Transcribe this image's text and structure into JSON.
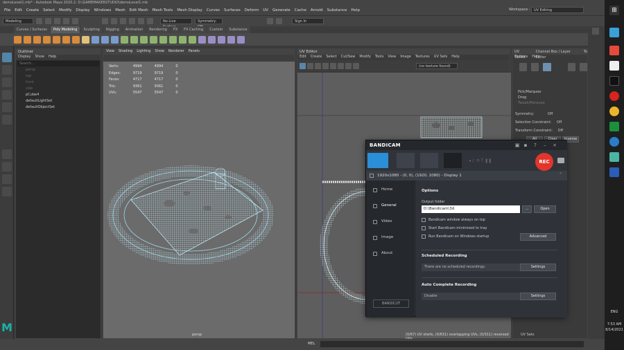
{
  "titlebar": {
    "text": "demoLevel1.mb* - Autodesk Maya 2020.2: D:\\GAMEMAKERSTUDIO\\demoLevel1.mb"
  },
  "menubar": {
    "items": [
      "File",
      "Edit",
      "Create",
      "Select",
      "Modify",
      "Display",
      "Windows",
      "Mesh",
      "Edit Mesh",
      "Mesh Tools",
      "Mesh Display",
      "Curves",
      "Surfaces",
      "Deform",
      "UV",
      "Generate",
      "Cache",
      "Arnold",
      "Substance",
      "Help"
    ],
    "workspace_label": "Workspace :",
    "workspace_value": "UV Editing"
  },
  "statusline": {
    "mode": "Modeling",
    "live_surface": "No Live Surface",
    "symmetry": "Symmetry: Off",
    "sign_in": "Sign In"
  },
  "shelf_tabs": [
    "Curves / Surfaces",
    "Poly Modeling",
    "Sculpting",
    "Rigging",
    "Animation",
    "Rendering",
    "FX",
    "FX Caching",
    "Custom",
    "Substance"
  ],
  "shelf_active": "Poly Modeling",
  "outliner": {
    "title": "Outliner",
    "menu": [
      "Display",
      "Show",
      "Help"
    ],
    "search_placeholder": "Search...",
    "items": [
      {
        "label": "persp",
        "dim": true
      },
      {
        "label": "top",
        "dim": true
      },
      {
        "label": "front",
        "dim": true
      },
      {
        "label": "side",
        "dim": true
      },
      {
        "label": "pCube4",
        "dim": false
      },
      {
        "label": "defaultLightSet",
        "dim": false
      },
      {
        "label": "defaultObjectSet",
        "dim": false
      }
    ]
  },
  "viewport": {
    "menu": [
      "View",
      "Shading",
      "Lighting",
      "Show",
      "Renderer",
      "Panels"
    ],
    "hud": [
      {
        "label": "Verts:",
        "v1": "4994",
        "v2": "4994",
        "v3": "0"
      },
      {
        "label": "Edges:",
        "v1": "9719",
        "v2": "9719",
        "v3": "0"
      },
      {
        "label": "Faces:",
        "v1": "4717",
        "v2": "4717",
        "v3": "0"
      },
      {
        "label": "Tris:",
        "v1": "9361",
        "v2": "9361",
        "v3": "0"
      },
      {
        "label": "UVs:",
        "v1": "5547",
        "v2": "5547",
        "v3": "0"
      }
    ],
    "camera": "persp"
  },
  "uveditor": {
    "title": "UV Editor",
    "menu": [
      "Edit",
      "Create",
      "Select",
      "Cut/Sew",
      "Modify",
      "Tools",
      "View",
      "Image",
      "Textures",
      "UV Sets",
      "Help"
    ],
    "texture_dropdown": "(no texture found)",
    "status": "(0/67) UV shells, (0/631) overlapping UVs, (0/311) reversed UVs"
  },
  "uvtoolkit": {
    "tabs": [
      "UV Toolkit",
      "Channel Box / Layer Editor",
      "To"
    ],
    "menu": [
      "Options",
      "Help"
    ],
    "pick_marquee": "Pick/Marquee",
    "drag": "Drag",
    "tweak": "Tweak/Marquee",
    "symmetry_label": "Symmetry:",
    "symmetry_value": "Off",
    "sel_constraint_label": "Selection Constraint:",
    "sel_constraint_value": "Off",
    "trans_constraint_label": "Transform Constraint:",
    "trans_constraint_value": "Off",
    "buttons": [
      "All",
      "Clear",
      "Inverse"
    ],
    "uv_sets": "UV Sets"
  },
  "bottombar": {
    "mel": "MEL"
  },
  "taskbar": {
    "time": "7:53 AM",
    "date": "8/14/2021",
    "lang": "ENG"
  },
  "bandicam": {
    "logo": "BANDICAM",
    "display_line": "1920x1080 - (0, 0), (1920, 1080) - Display 1",
    "rec": "REC",
    "nav": [
      "Home",
      "General",
      "Video",
      "Image",
      "About"
    ],
    "nav_active": "General",
    "options_title": "Options",
    "output_folder_label": "Output folder",
    "output_folder_value": "D:\\Bandicam\\3d",
    "browse": "...",
    "open": "Open",
    "checks": [
      "Bandicam window always on top",
      "Start Bandicam minimized to tray",
      "Run Bandicam on Windows startup"
    ],
    "advanced": "Advanced",
    "scheduled_title": "Scheduled Recording",
    "scheduled_value": "There are no scheduled recordings.",
    "settings": "Settings",
    "auto_title": "Auto Complete Recording",
    "auto_value": "Disable",
    "bandicut": "BANDICUT"
  }
}
